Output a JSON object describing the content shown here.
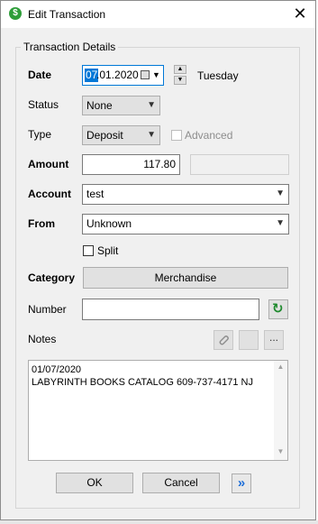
{
  "window": {
    "title": "Edit Transaction",
    "close_glyph": "✕",
    "app_icon_glyph": "$"
  },
  "group": {
    "label": "Transaction Details"
  },
  "date": {
    "label": "Date",
    "value_selected": "07",
    "value_rest": ".01.2020",
    "weekday": "Tuesday"
  },
  "status": {
    "label": "Status",
    "value": "None"
  },
  "type": {
    "label": "Type",
    "value": "Deposit",
    "advanced_label": "Advanced",
    "advanced_checked": false
  },
  "amount": {
    "label": "Amount",
    "value": "117.80"
  },
  "account": {
    "label": "Account",
    "value": "test"
  },
  "from": {
    "label": "From",
    "value": "Unknown"
  },
  "split": {
    "label": "Split",
    "checked": false
  },
  "category": {
    "label": "Category",
    "value": "Merchandise"
  },
  "number": {
    "label": "Number",
    "value": ""
  },
  "notes": {
    "label": "Notes",
    "lines": [
      "01/07/2020",
      "LABYRINTH BOOKS CATALOG 609-737-4171 NJ"
    ],
    "more_glyph": "..."
  },
  "buttons": {
    "ok": "OK",
    "cancel": "Cancel",
    "next_glyph": "»"
  },
  "icons": {
    "calendar": "calendar-icon",
    "refresh": "refresh-icon",
    "attach": "paperclip-icon",
    "next": "double-chevron-right-icon"
  },
  "colors": {
    "accent": "#0078d7",
    "refresh_green": "#1f8a2e",
    "next_blue": "#1e6fd9"
  }
}
